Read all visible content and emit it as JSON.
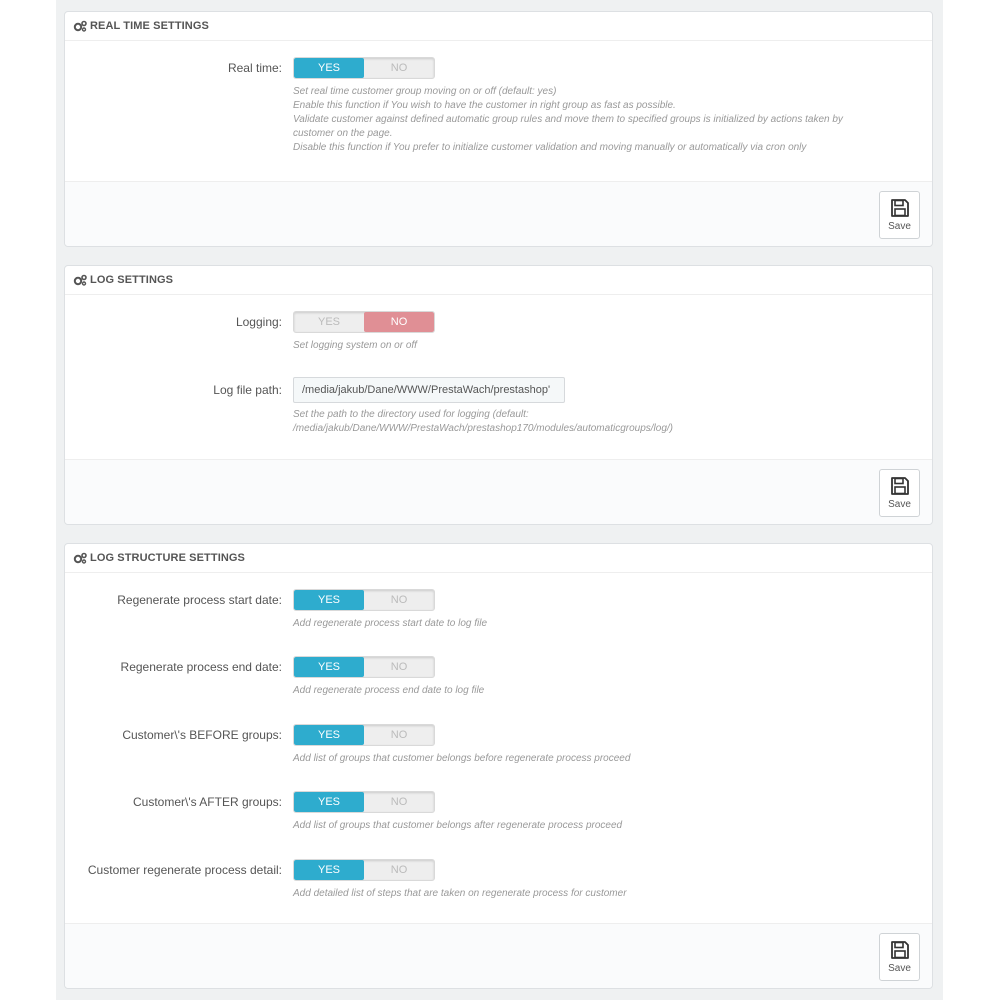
{
  "colors": {
    "yes_active": "#2eacce",
    "no_active": "#e08f95"
  },
  "realtime": {
    "title": "REAL TIME SETTINGS",
    "label": "Real time:",
    "yes": "YES",
    "no": "NO",
    "selected": "yes",
    "help": [
      "Set real time customer group moving on or off (default: yes)",
      "Enable this function if You wish to have the customer in right group as fast as possible.",
      "Validate customer against defined automatic group rules and move them to specified groups is initialized by actions taken by",
      "customer on the page.",
      "Disable this function if You prefer to initialize customer validation and moving manually or automatically via cron only"
    ],
    "save": "Save"
  },
  "log": {
    "title": "LOG SETTINGS",
    "logging_label": "Logging:",
    "yes": "YES",
    "no": "NO",
    "selected": "no",
    "logging_help": "Set logging system on or off",
    "path_label": "Log file path:",
    "path_value": "/media/jakub/Dane/WWW/PrestaWach/prestashop'",
    "path_help": [
      "Set the path to the directory used for logging (default:",
      "/media/jakub/Dane/WWW/PrestaWach/prestashop170/modules/automaticgroups/log/)"
    ],
    "save": "Save"
  },
  "structure": {
    "title": "LOG STRUCTURE SETTINGS",
    "yes": "YES",
    "no": "NO",
    "items": [
      {
        "label": "Regenerate process start date:",
        "help": "Add regenerate process start date to log file",
        "selected": "yes"
      },
      {
        "label": "Regenerate process end date:",
        "help": "Add regenerate process end date to log file",
        "selected": "yes"
      },
      {
        "label": "Customer\\'s BEFORE groups:",
        "help": "Add list of groups that customer belongs before regenerate process proceed",
        "selected": "yes"
      },
      {
        "label": "Customer\\'s AFTER groups:",
        "help": "Add list of groups that customer belongs after regenerate process proceed",
        "selected": "yes"
      },
      {
        "label": "Customer regenerate process detail:",
        "help": "Add detailed list of steps that are taken on regenerate process for customer",
        "selected": "yes"
      }
    ],
    "save": "Save"
  }
}
